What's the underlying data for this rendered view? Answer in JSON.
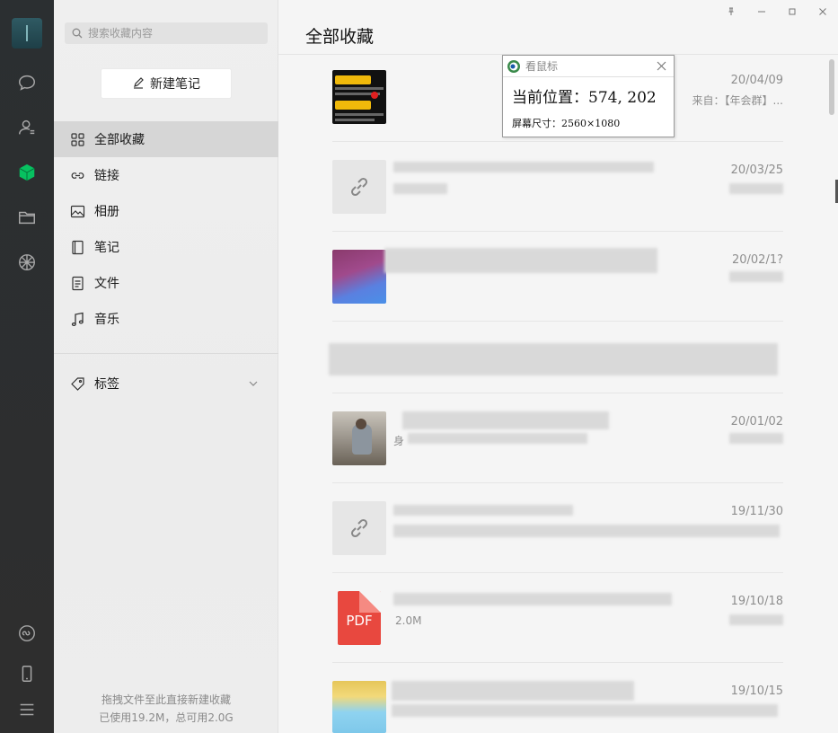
{
  "rail": {
    "icons": [
      "chat-icon",
      "contacts-icon",
      "favorites-icon",
      "folder-icon",
      "moments-icon",
      "miniprogram-icon",
      "phone-icon",
      "menu-icon"
    ],
    "accent": "#07c160"
  },
  "sidebar": {
    "search_placeholder": "搜索收藏内容",
    "new_note_label": "新建笔记",
    "items": [
      {
        "label": "全部收藏",
        "icon": "grid-icon",
        "active": true
      },
      {
        "label": "链接",
        "icon": "link-icon"
      },
      {
        "label": "相册",
        "icon": "image-icon"
      },
      {
        "label": "笔记",
        "icon": "note-icon"
      },
      {
        "label": "文件",
        "icon": "file-icon"
      },
      {
        "label": "音乐",
        "icon": "music-icon"
      }
    ],
    "tags_label": "标签",
    "footer_line1": "拖拽文件至此直接新建收藏",
    "footer_line2": "已使用19.2M，总可用2.0G"
  },
  "main": {
    "title": "全部收藏",
    "items": [
      {
        "date": "20/04/09",
        "sub": "来自：【年会群】...",
        "kind": "image"
      },
      {
        "date": "20/03/25",
        "kind": "link"
      },
      {
        "date": "20/02/1?",
        "kind": "image"
      },
      {
        "date": "",
        "kind": "text"
      },
      {
        "date": "20/01/02",
        "sub": "身",
        "kind": "image"
      },
      {
        "date": "19/11/30",
        "kind": "link"
      },
      {
        "date": "19/10/18",
        "sub": "2.0M",
        "kind": "pdf",
        "badge": "PDF"
      },
      {
        "date": "19/10/15",
        "kind": "image"
      }
    ]
  },
  "tooltip": {
    "title": "看鼠标",
    "position_text": "当前位置：574, 202",
    "size_text": "屏幕尺寸：2560×1080"
  }
}
